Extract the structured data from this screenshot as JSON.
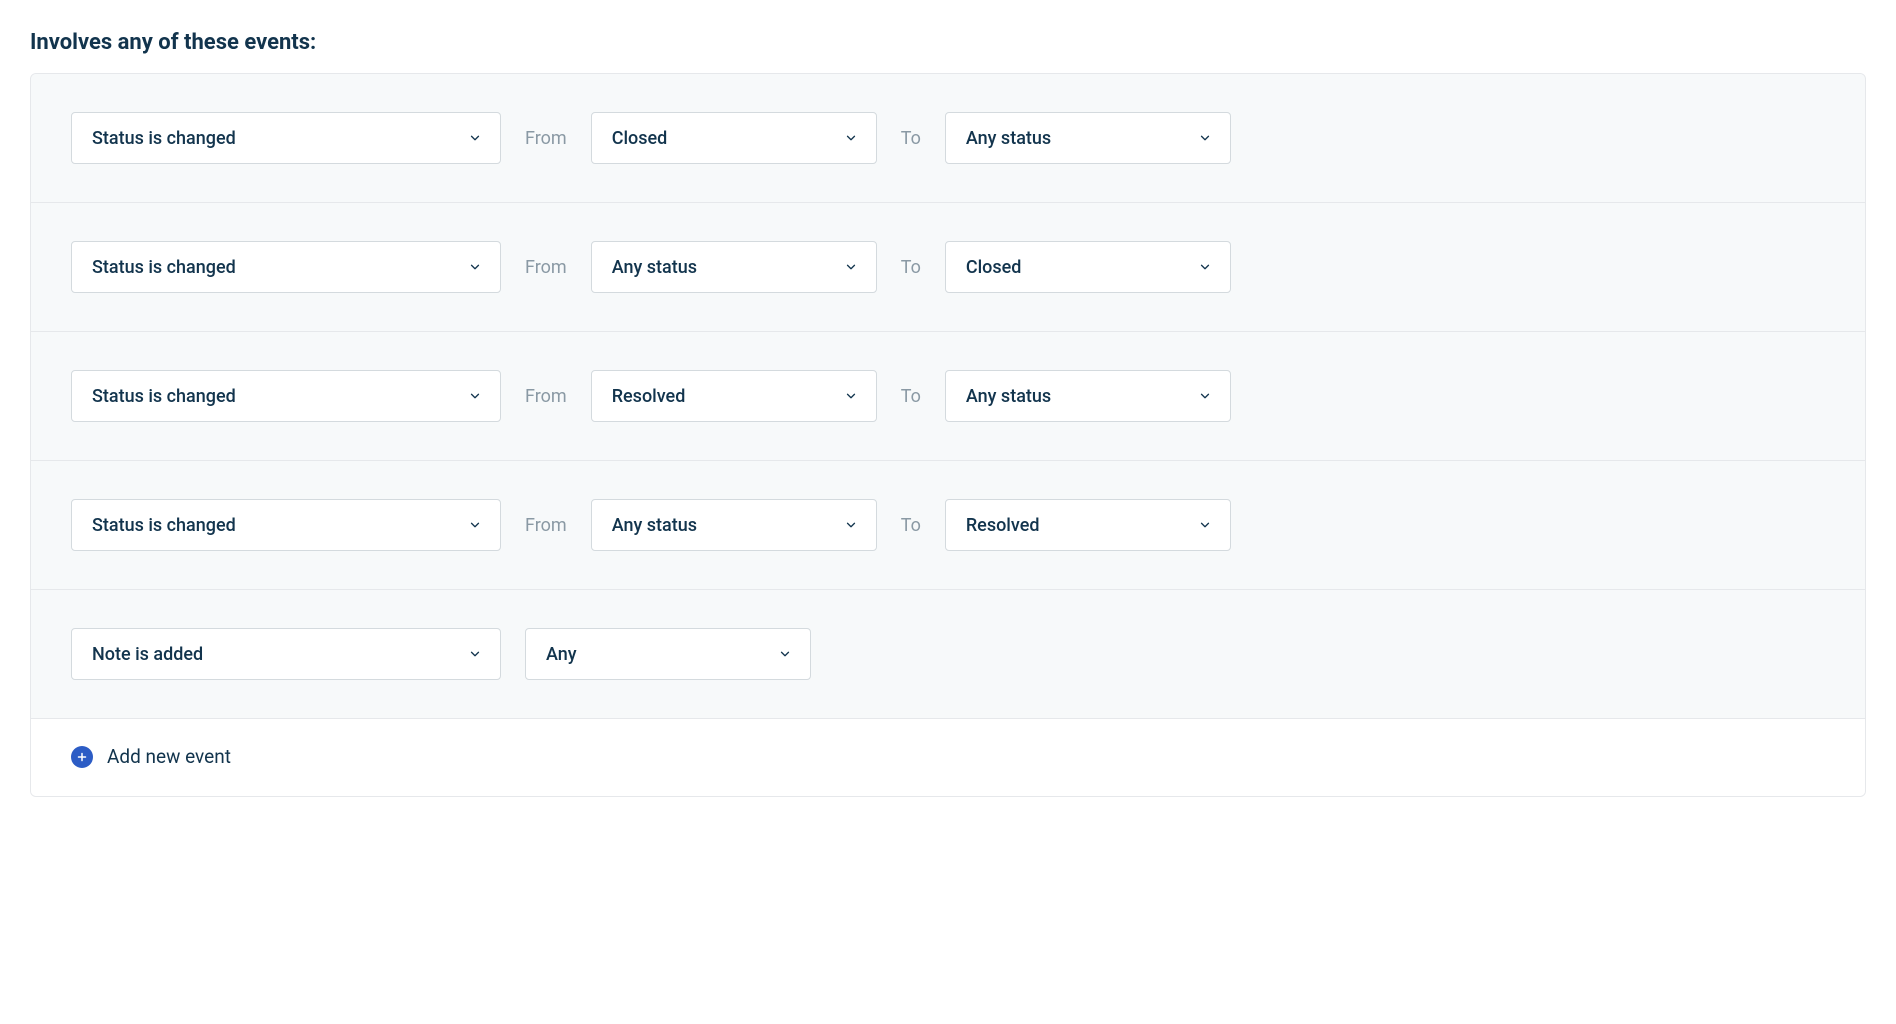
{
  "section": {
    "title": "Involves any of these events:"
  },
  "labels": {
    "from": "From",
    "to": "To",
    "add_new_event": "Add new event"
  },
  "events": [
    {
      "type": "Status is changed",
      "from": "Closed",
      "to": "Any status"
    },
    {
      "type": "Status is changed",
      "from": "Any status",
      "to": "Closed"
    },
    {
      "type": "Status is changed",
      "from": "Resolved",
      "to": "Any status"
    },
    {
      "type": "Status is changed",
      "from": "Any status",
      "to": "Resolved"
    },
    {
      "type": "Note is added",
      "note_option": "Any"
    }
  ]
}
